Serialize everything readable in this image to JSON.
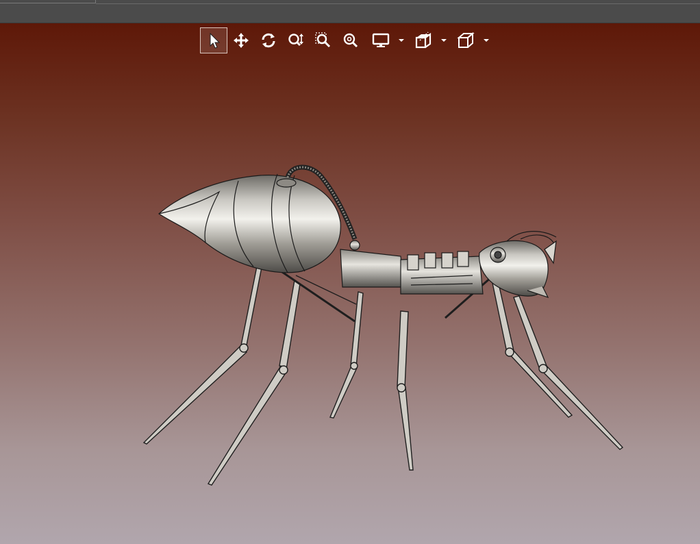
{
  "window": {
    "active_tool": "select"
  },
  "toolbar": {
    "buttons": [
      {
        "name": "select-tool",
        "icon": "cursor-arrow-icon",
        "active": true
      },
      {
        "name": "pan-tool",
        "icon": "move-arrows-icon",
        "active": false
      },
      {
        "name": "rotate-tool",
        "icon": "rotate-icon",
        "active": false
      },
      {
        "name": "zoom-tool",
        "icon": "zoom-updown-icon",
        "active": false
      },
      {
        "name": "zoom-window-tool",
        "icon": "zoom-window-icon",
        "active": false
      },
      {
        "name": "zoom-fit-tool",
        "icon": "zoom-fit-icon",
        "active": false
      },
      {
        "name": "display-mode-dropdown",
        "icon": "monitor-icon",
        "active": false
      },
      {
        "name": "section-dropdown",
        "icon": "section-cut-icon",
        "active": false
      },
      {
        "name": "view-cube-dropdown",
        "icon": "cube-icon",
        "active": false
      }
    ]
  },
  "viewport": {
    "background_top": "#5e1808",
    "background_bottom": "#b1a6ad",
    "model_name": "mechanical-ant-model",
    "model_color": "#b8b4ae"
  }
}
